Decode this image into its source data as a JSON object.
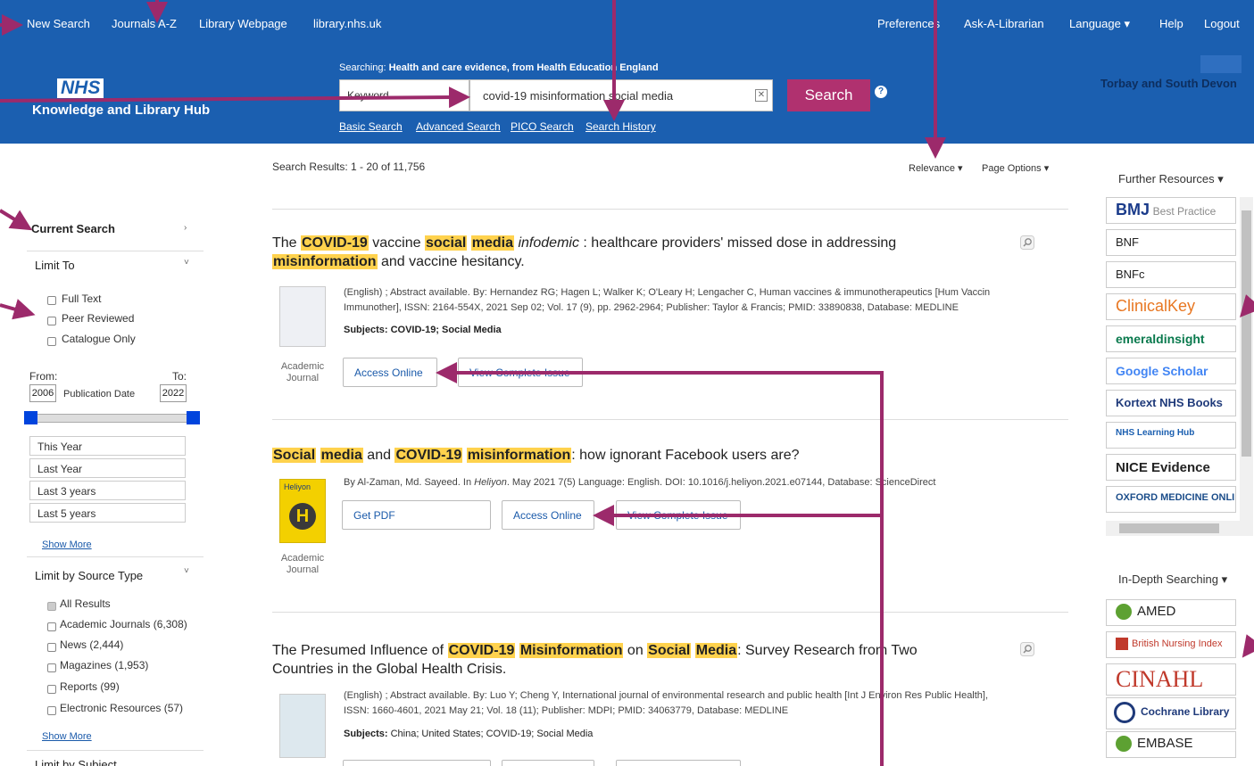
{
  "topnav": {
    "left_links": [
      "New Search",
      "Journals A-Z",
      "Library Webpage",
      "library.nhs.uk"
    ],
    "right_links": [
      "Preferences",
      "Ask-A-Librarian",
      "Language ▾",
      "Help",
      "Logout"
    ]
  },
  "header": {
    "logo": "NHS",
    "hub_name": "Knowledge and Library Hub",
    "searching_prefix": "Searching: ",
    "searching_source": "Health and care evidence, from Health Education England",
    "field_select": "Keyword",
    "search_value": "covid-19 misinformation social media",
    "search_button": "Search",
    "help": "?",
    "sublinks": [
      "Basic Search",
      "Advanced Search",
      "PICO Search",
      "Search History"
    ],
    "org_name": "Torbay and South Devon"
  },
  "sidebar": {
    "current_search": "Current Search",
    "limit_to": "Limit To",
    "limit_options": [
      "Full Text",
      "Peer Reviewed",
      "Catalogue Only"
    ],
    "from_label": "From:",
    "to_label": "To:",
    "from_year": "2006",
    "to_year": "2022",
    "pub_date_label": "Publication Date",
    "date_options": [
      "This Year",
      "Last Year",
      "Last 3 years",
      "Last 5 years"
    ],
    "show_more": "Show More",
    "source_type_head": "Limit by Source Type",
    "source_types": [
      "All Results",
      "Academic Journals (6,308)",
      "News (2,444)",
      "Magazines (1,953)",
      "Reports (99)",
      "Electronic Resources (57)"
    ],
    "subject_head": "Limit by Subject"
  },
  "results": {
    "count": "Search Results: 1 - 20 of 11,756",
    "sort": "Relevance",
    "page_options": "Page Options",
    "items": [
      {
        "t1": "The ",
        "t2": "COVID-19",
        "t3": " vaccine ",
        "t4": "social",
        "t5": " ",
        "t6": "media",
        "t7": " ",
        "t8": "infodemic",
        "t9": " : healthcare providers' missed dose in addressing",
        "t10": "misinformation",
        "t11": " and vaccine hesitancy.",
        "meta1": "(English) ; Abstract available. By: Hernandez RG; Hagen L; Walker K; O'Leary H; Lengacher C, Human vaccines & immunotherapeutics [Hum Vaccin",
        "meta2": "Immunother], ISSN: 2164-554X, 2021 Sep 02; Vol. 17 (9), pp. 2962-2964; Publisher: Taylor & Francis; PMID: 33890838, Database: MEDLINE",
        "subjects_label": "Subjects:",
        "subjects": " COVID-19; Social Media",
        "type": "Academic Journal",
        "btn1": "Access Online",
        "btn2": "View Complete Issue"
      },
      {
        "t1": "Social",
        "t2": " ",
        "t3": "media",
        "t4": " and ",
        "t5": "COVID-19",
        "t6": " ",
        "t7": "misinformation",
        "t8": ": how ignorant Facebook users are?",
        "meta1_a": "By Al-Zaman, Md. Sayeed. In ",
        "meta1_b": "Heliyon",
        "meta1_c": ". May 2021 7(5) Language: English. DOI: 10.1016/j.heliyon.2021.e07144, Database: ScienceDirect",
        "thumb_label": "Heliyon",
        "thumb_letter": "H",
        "type": "Academic Journal",
        "btn1": "Get PDF",
        "btn2": "Access Online",
        "btn3": "View Complete Issue"
      },
      {
        "t1": "The Presumed Influence of ",
        "t2": "COVID-19",
        "t3": " ",
        "t4": "Misinformation",
        "t5": " on ",
        "t6": "Social",
        "t7": " ",
        "t8": "Media",
        "t9": ": Survey Research from Two",
        "t10": "Countries in the Global Health Crisis.",
        "meta1": "(English) ; Abstract available. By: Luo Y; Cheng Y, International journal of environmental research and public health [Int J Environ Res Public Health],",
        "meta2": "ISSN: 1660-4601, 2021 May 21; Vol. 18 (11); Publisher: MDPI; PMID: 34063779, Database: MEDLINE",
        "subjects_label": "Subjects:",
        "subjects": " China; United States; COVID-19; Social Media"
      }
    ]
  },
  "right": {
    "further_head": "Further Resources",
    "further": [
      "BMJ Best Practice",
      "BNF",
      "BNFc",
      "ClinicalKey",
      "emeraldinsight",
      "Google Scholar",
      "Kortext NHS Books",
      "NHS Learning Hub",
      "NICE Evidence",
      "OXFORD MEDICINE ONLINE"
    ],
    "indepth_head": "In-Depth Searching",
    "indepth": [
      "AMED",
      "British Nursing Index",
      "CINAHL",
      "Cochrane Library",
      "EMBASE"
    ]
  },
  "colors": {
    "nav_blue": "#1b5fb0",
    "accent_magenta": "#b0316f",
    "highlight": "#ffd24d",
    "link_blue": "#1a5aaa"
  }
}
